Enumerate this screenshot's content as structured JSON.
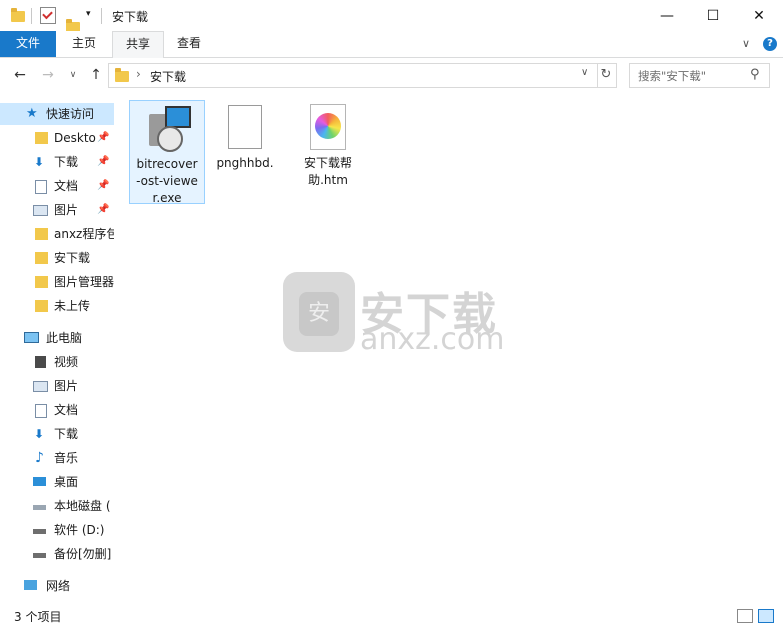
{
  "window": {
    "title": "安下载",
    "controls": {
      "minimize": "—",
      "maximize": "☐",
      "close": "✕"
    }
  },
  "ribbon": {
    "tabs": [
      "文件",
      "主页",
      "共享",
      "查看"
    ],
    "help_icon": "?"
  },
  "address": {
    "path_sep": "›",
    "path": "安下载",
    "search_placeholder": "搜索\"安下载\""
  },
  "nav_pane": {
    "quick_access": "快速访问",
    "quick_items": [
      "Deskto",
      "下载",
      "文档",
      "图片",
      "anxz程序包",
      "安下载",
      "图片管理器",
      "未上传"
    ],
    "this_pc": "此电脑",
    "pc_items": [
      "视频",
      "图片",
      "文档",
      "下载",
      "音乐",
      "桌面",
      "本地磁盘 (",
      "软件 (D:)",
      "备份[勿删]"
    ],
    "network": "网络"
  },
  "files": [
    {
      "name": "bitrecover-ost-viewer.exe",
      "lines": [
        "bitrecover",
        "-ost-viewe",
        "r.exe"
      ],
      "icon": "installer-icon",
      "selected": true
    },
    {
      "name": "pnghhbd.",
      "lines": [
        "pnghhbd."
      ],
      "icon": "blank-file-icon",
      "selected": false
    },
    {
      "name": "安下载帮助.htm",
      "lines": [
        "安下载帮",
        "助.htm"
      ],
      "icon": "photos-htm-icon",
      "selected": false
    }
  ],
  "watermark": {
    "cn": "安下载",
    "en": "anxz.com",
    "badge": "安"
  },
  "status": {
    "count": "3 个项目"
  },
  "colors": {
    "accent": "#1979ca",
    "selected": "#cce8ff",
    "folder": "#f2c84b"
  }
}
